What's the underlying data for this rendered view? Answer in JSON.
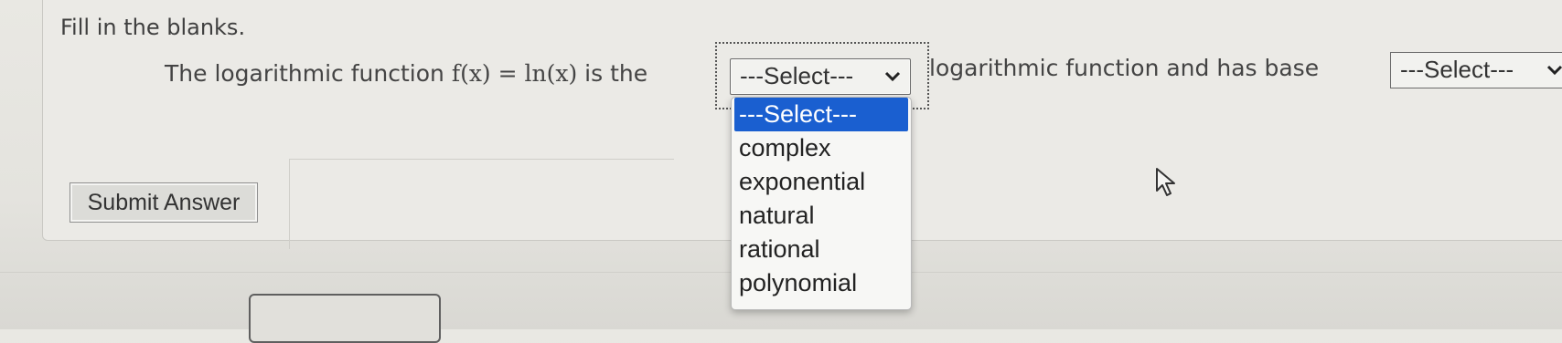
{
  "instruction": "Fill in the blanks.",
  "question": {
    "prefix": "The logarithmic function ",
    "math": "f(x) = ln(x)",
    "is_the": " is the",
    "middle": "logarithmic function and has base",
    "select1": {
      "value": "---Select---"
    },
    "select2": {
      "value": "---Select---"
    },
    "options": [
      "---Select---",
      "complex",
      "exponential",
      "natural",
      "rational",
      "polynomial"
    ],
    "selected_index": 0
  },
  "submit_label": "Submit Answer",
  "colors": {
    "highlight": "#1a5fd0"
  },
  "icons": [
    "chevron-down-icon",
    "mouse-pointer-icon"
  ]
}
